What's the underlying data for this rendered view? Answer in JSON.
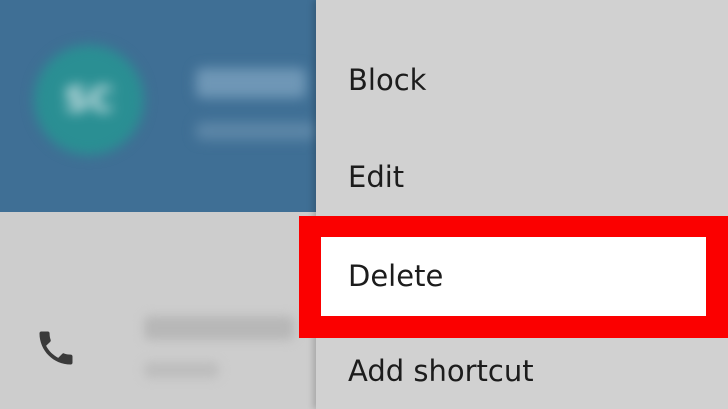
{
  "contact": {
    "avatar_initials": "SC",
    "phone_icon": "phone-icon"
  },
  "menu": {
    "items": [
      {
        "label": "Block"
      },
      {
        "label": "Edit"
      },
      {
        "label": "Delete",
        "highlighted": true
      },
      {
        "label": "Add shortcut"
      }
    ],
    "highlight_color": "#ff0000"
  },
  "colors": {
    "header": "#3f6f95",
    "avatar": "#2a8f93",
    "menu_bg": "#d1d1d1"
  }
}
